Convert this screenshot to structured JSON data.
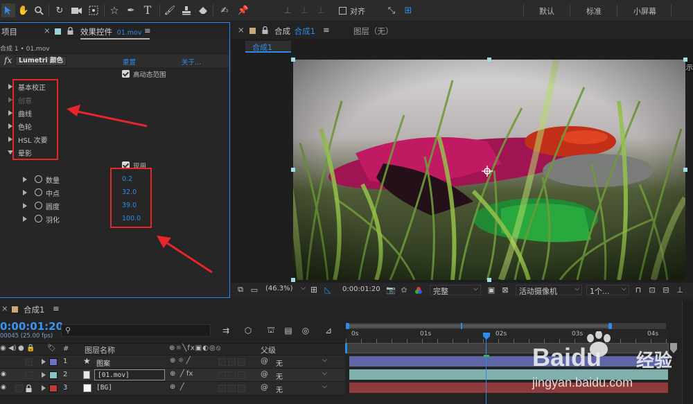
{
  "workspaces": [
    "默认",
    "标准",
    "小屏幕"
  ],
  "toolbar": {
    "align_label": "对齐"
  },
  "project_panel": {
    "tab": "项目"
  },
  "effects_panel": {
    "tab_prefix": "效果控件",
    "tab_file": "01.mov",
    "breadcrumb": "合成 1 • 01.mov",
    "fx_badge": "fx",
    "effect_name": "Lumetri 颜色",
    "reset_link": "重置",
    "about_link": "关于...",
    "hdr_label": "高动态范围",
    "sections": [
      "基本校正",
      "创意",
      "曲线",
      "色轮",
      "HSL 次要",
      "晕影"
    ],
    "vignette_enable_label": "现用",
    "params": [
      {
        "label": "数量",
        "value": "0.2"
      },
      {
        "label": "中点",
        "value": "32.0"
      },
      {
        "label": "圆度",
        "value": "39.0"
      },
      {
        "label": "羽化",
        "value": "100.0"
      }
    ]
  },
  "comp_panel": {
    "tab_prefix": "合成",
    "tab_name": "合成1",
    "layer_tab": "图层（无）",
    "subtab": "合成1",
    "edge_label": "显示",
    "zoom": "(46.3%)",
    "timecode": "0:00:01:20",
    "quality": "完整",
    "camera": "活动摄像机",
    "views": "1个..."
  },
  "timeline": {
    "tab": "合成1",
    "timecode": "0:00:01:20",
    "frame_info": "00045 (25.00 fps)",
    "search_placeholder": "",
    "col_hash": "#",
    "col_layer_name": "图层名称",
    "col_parent": "父级",
    "ruler_labels": [
      "0s",
      "01s",
      "02s",
      "03s",
      "04s"
    ],
    "layers": [
      {
        "num": "1",
        "name": "图案",
        "parent": "无",
        "color": "#6a72c8"
      },
      {
        "num": "2",
        "name": "[01.mov]",
        "parent": "无",
        "color": "#86c4c4"
      },
      {
        "num": "3",
        "name": "[BG]",
        "parent": "无",
        "color": "#c23a3a"
      }
    ]
  },
  "watermark": {
    "brand": "Bai",
    "cn": "经验",
    "url": "jingyan.baidu.com"
  },
  "colors": {
    "accent": "#2d8ceb",
    "annotation": "#e8252a",
    "track1": "#5e66a8",
    "track2": "#7fb0ac",
    "track3": "#8e3b3b"
  }
}
